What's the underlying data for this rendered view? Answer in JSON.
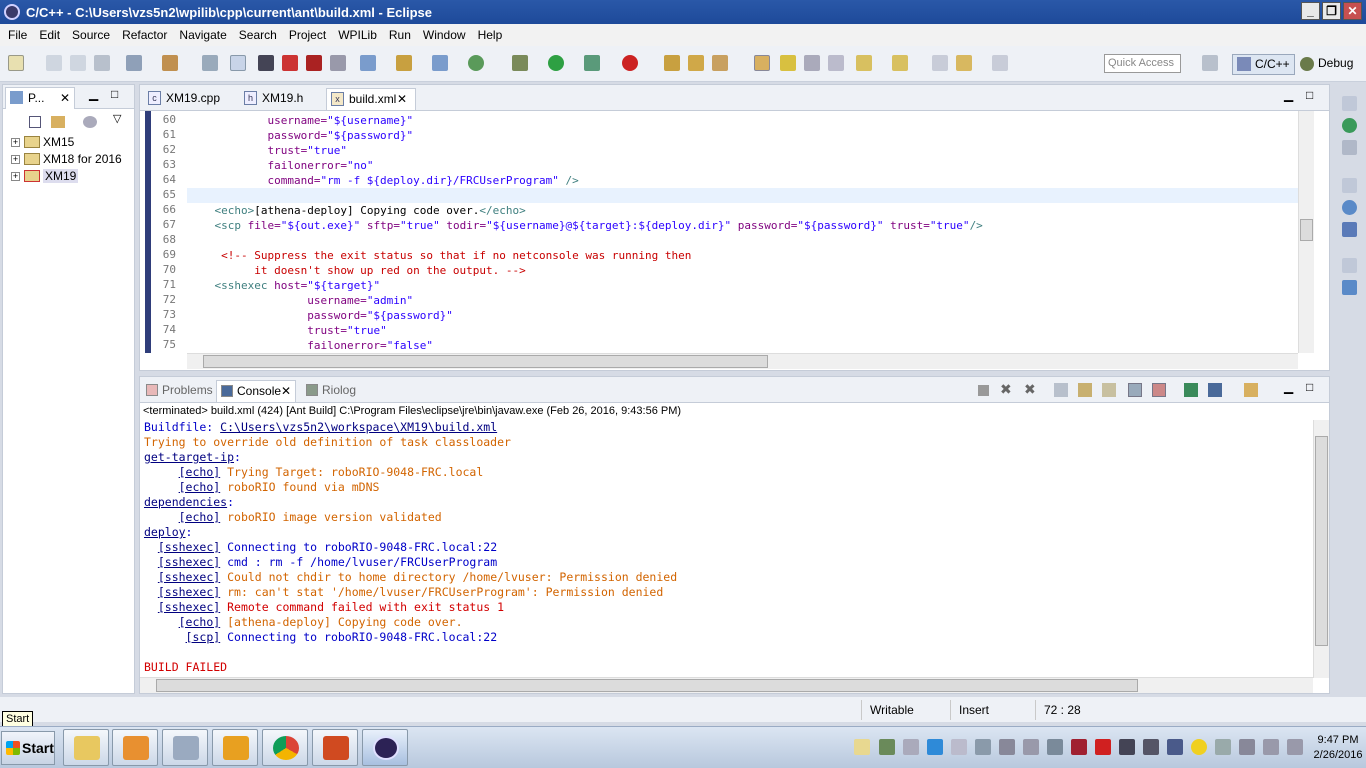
{
  "window": {
    "title": "C/C++ - C:\\Users\\vzs5n2\\wpilib\\cpp\\current\\ant\\build.xml - Eclipse",
    "min": "_",
    "max": "❐",
    "close": "✕"
  },
  "menu": [
    "File",
    "Edit",
    "Source",
    "Refactor",
    "Navigate",
    "Search",
    "Project",
    "WPILib",
    "Run",
    "Window",
    "Help"
  ],
  "toolbar": {
    "quick_access_placeholder": "Quick Access",
    "perspective_cpp": "C/C++",
    "perspective_debug": "Debug"
  },
  "project_explorer": {
    "tab_label": "P...",
    "items": [
      {
        "label": "XM15"
      },
      {
        "label": "XM18 for 2016"
      },
      {
        "label": "XM19"
      }
    ]
  },
  "editor": {
    "tabs": [
      {
        "label": "XM19.cpp",
        "icon": "c-file-icon"
      },
      {
        "label": "XM19.h",
        "icon": "h-file-icon"
      },
      {
        "label": "build.xml",
        "icon": "xml-file-icon"
      }
    ],
    "lines": [
      {
        "n": "60",
        "segs": [
          [
            "a",
            "            username="
          ],
          [
            "v",
            "\"${username}\""
          ]
        ]
      },
      {
        "n": "61",
        "segs": [
          [
            "a",
            "            password="
          ],
          [
            "v",
            "\"${password}\""
          ]
        ]
      },
      {
        "n": "62",
        "segs": [
          [
            "a",
            "            trust="
          ],
          [
            "v",
            "\"true\""
          ]
        ]
      },
      {
        "n": "63",
        "segs": [
          [
            "a",
            "            failonerror="
          ],
          [
            "v",
            "\"no\""
          ]
        ]
      },
      {
        "n": "64",
        "segs": [
          [
            "a",
            "            command="
          ],
          [
            "v",
            "\"rm -f ${deploy.dir}/FRCUserProgram\""
          ],
          [
            "t",
            " />"
          ]
        ]
      },
      {
        "n": "65",
        "segs": []
      },
      {
        "n": "66",
        "segs": [
          [
            "t",
            "    <echo>"
          ],
          [
            "x",
            "[athena-deploy] Copying code over."
          ],
          [
            "t",
            "</echo>"
          ]
        ]
      },
      {
        "n": "67",
        "segs": [
          [
            "t",
            "    <scp "
          ],
          [
            "a",
            "file="
          ],
          [
            "v",
            "\"${out.exe}\""
          ],
          [
            "a",
            " sftp="
          ],
          [
            "v",
            "\"true\""
          ],
          [
            "a",
            " todir="
          ],
          [
            "v",
            "\"${username}@${target}:${deploy.dir}\""
          ],
          [
            "a",
            " password="
          ],
          [
            "v",
            "\"${password}\""
          ],
          [
            "a",
            " trust="
          ],
          [
            "v",
            "\"true\""
          ],
          [
            "t",
            "/>"
          ]
        ]
      },
      {
        "n": "68",
        "segs": []
      },
      {
        "n": "69",
        "segs": [
          [
            "c",
            "     <!-- Suppress the exit status so that if no netconsole was running then"
          ]
        ]
      },
      {
        "n": "70",
        "segs": [
          [
            "c",
            "          it doesn't show up red on the output. -->"
          ]
        ]
      },
      {
        "n": "71",
        "segs": [
          [
            "t",
            "    <sshexec "
          ],
          [
            "a",
            "host="
          ],
          [
            "v",
            "\"${target}\""
          ]
        ]
      },
      {
        "n": "72",
        "segs": [
          [
            "a",
            "                  username="
          ],
          [
            "v",
            "\"admin\""
          ]
        ]
      },
      {
        "n": "73",
        "segs": [
          [
            "a",
            "                  password="
          ],
          [
            "v",
            "\"${password}\""
          ]
        ]
      },
      {
        "n": "74",
        "segs": [
          [
            "a",
            "                  trust="
          ],
          [
            "v",
            "\"true\""
          ]
        ]
      },
      {
        "n": "75",
        "segs": [
          [
            "a",
            "                  failonerror="
          ],
          [
            "v",
            "\"false\""
          ]
        ]
      }
    ]
  },
  "console": {
    "tabs": [
      {
        "label": "Problems"
      },
      {
        "label": "Console"
      },
      {
        "label": "Riolog"
      }
    ],
    "terminated": "<terminated> build.xml (424) [Ant Build] C:\\Program Files\\eclipse\\jre\\bin\\javaw.exe (Feb 26, 2016, 9:43:56 PM)",
    "lines": [
      {
        "segs": [
          [
            "b",
            "Buildfile: "
          ],
          [
            "l",
            "C:\\Users\\vzs5n2\\workspace\\XM19\\build.xml"
          ]
        ]
      },
      {
        "segs": [
          [
            "o",
            "Trying to override old definition of task classloader"
          ]
        ]
      },
      {
        "segs": [
          [
            "l",
            "get-target-ip"
          ],
          [
            "b",
            ":"
          ]
        ]
      },
      {
        "segs": [
          [
            "k",
            "     "
          ],
          [
            "l",
            "[echo]"
          ],
          [
            "o",
            " Trying Target: roboRIO-9048-FRC.local"
          ]
        ]
      },
      {
        "segs": [
          [
            "k",
            "     "
          ],
          [
            "l",
            "[echo]"
          ],
          [
            "o",
            " roboRIO found via mDNS"
          ]
        ]
      },
      {
        "segs": [
          [
            "l",
            "dependencies"
          ],
          [
            "b",
            ":"
          ]
        ]
      },
      {
        "segs": [
          [
            "k",
            "     "
          ],
          [
            "l",
            "[echo]"
          ],
          [
            "o",
            " roboRIO image version validated"
          ]
        ]
      },
      {
        "segs": [
          [
            "l",
            "deploy"
          ],
          [
            "b",
            ":"
          ]
        ]
      },
      {
        "segs": [
          [
            "k",
            "  "
          ],
          [
            "l",
            "[sshexec]"
          ],
          [
            "b",
            " Connecting to roboRIO-9048-FRC.local:22"
          ]
        ]
      },
      {
        "segs": [
          [
            "k",
            "  "
          ],
          [
            "l",
            "[sshexec]"
          ],
          [
            "b",
            " cmd : rm -f /home/lvuser/FRCUserProgram"
          ]
        ]
      },
      {
        "segs": [
          [
            "k",
            "  "
          ],
          [
            "l",
            "[sshexec]"
          ],
          [
            "o",
            " Could not chdir to home directory /home/lvuser: Permission denied"
          ]
        ]
      },
      {
        "segs": [
          [
            "k",
            "  "
          ],
          [
            "l",
            "[sshexec]"
          ],
          [
            "o",
            " rm: can't stat '/home/lvuser/FRCUserProgram': Permission denied"
          ]
        ]
      },
      {
        "segs": [
          [
            "k",
            "  "
          ],
          [
            "l",
            "[sshexec]"
          ],
          [
            "r",
            " Remote command failed with exit status 1"
          ]
        ]
      },
      {
        "segs": [
          [
            "k",
            "     "
          ],
          [
            "l",
            "[echo]"
          ],
          [
            "o",
            " [athena-deploy] Copying code over."
          ]
        ]
      },
      {
        "segs": [
          [
            "k",
            "      "
          ],
          [
            "l",
            "[scp]"
          ],
          [
            "b",
            " Connecting to roboRIO-9048-FRC.local:22"
          ]
        ]
      },
      {
        "segs": []
      },
      {
        "segs": [
          [
            "r",
            "BUILD FAILED"
          ]
        ]
      }
    ]
  },
  "statusbar": {
    "writable": "Writable",
    "insert": "Insert",
    "position": "72 : 28"
  },
  "tooltip": "Start",
  "taskbar": {
    "start_label": "Start",
    "time": "9:47 PM",
    "date": "2/26/2016"
  },
  "colors": {
    "xml_attr": "#7f007f",
    "xml_value": "#2a00ff",
    "xml_comment": "#c80000",
    "console_blue": "#0000c8",
    "console_orange": "#d26400",
    "console_red": "#d20000"
  }
}
